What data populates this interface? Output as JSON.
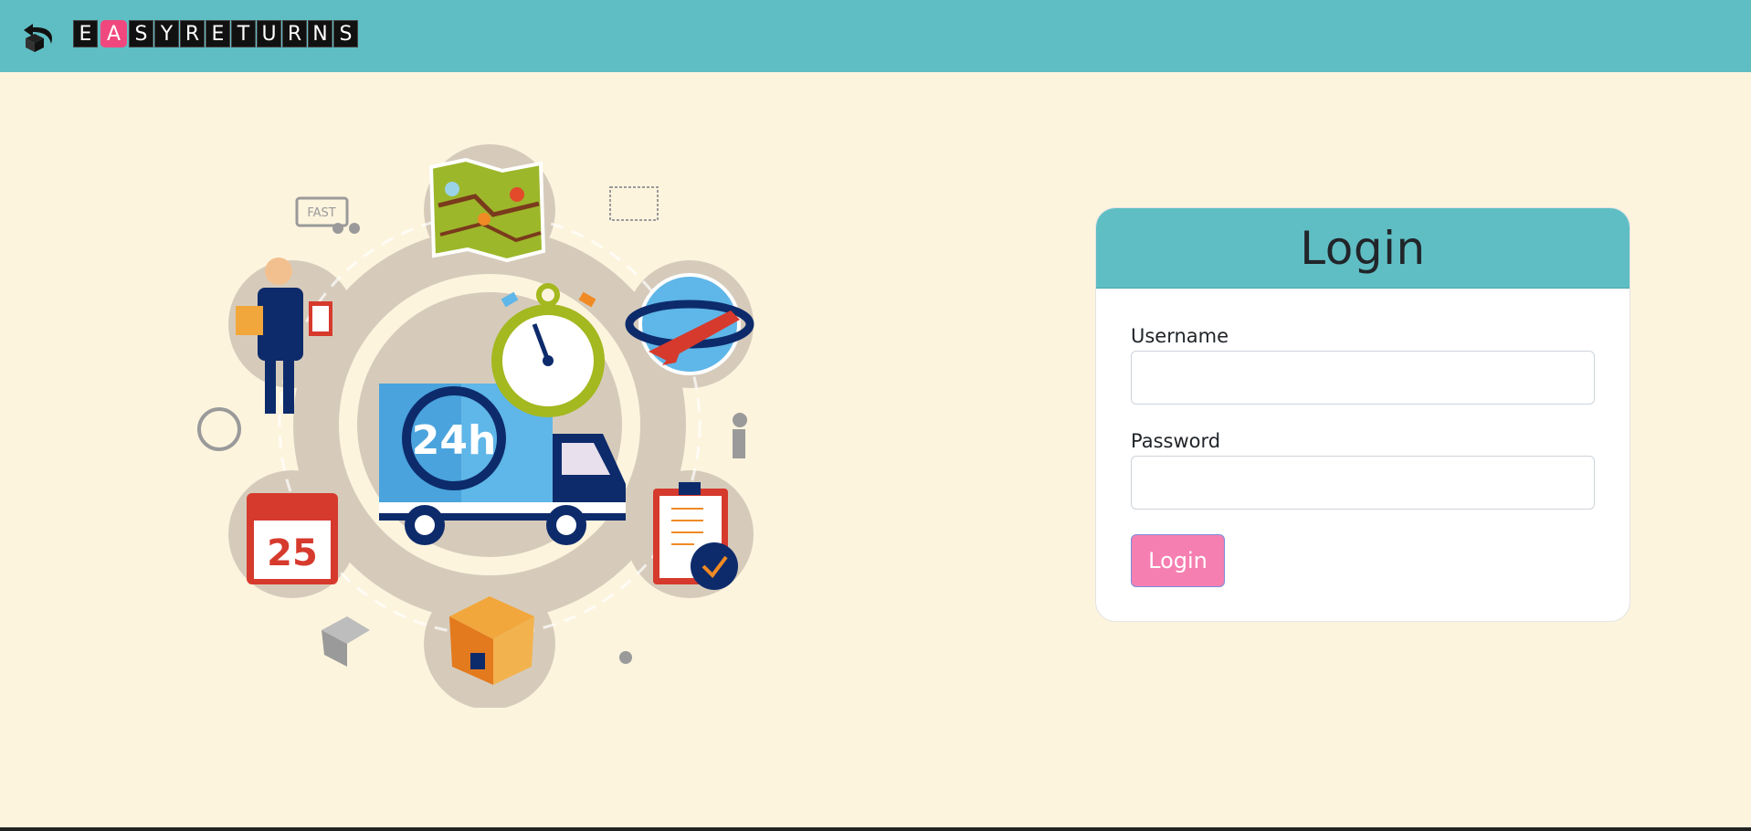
{
  "header": {
    "brand_letters": [
      "E",
      "A",
      "S",
      "Y",
      "R",
      "E",
      "T",
      "U",
      "R",
      "N",
      "S"
    ],
    "brand_text": "EASYRETURNS",
    "accent_color": "#5fbec4",
    "highlight_color": "#f0487e"
  },
  "illustration": {
    "center_label": "24h",
    "fast_label": "FAST",
    "calendar_day": "25"
  },
  "login": {
    "title": "Login",
    "username_label": "Username",
    "username_value": "",
    "password_label": "Password",
    "password_value": "",
    "button_label": "Login",
    "button_color": "#f57fb1"
  }
}
